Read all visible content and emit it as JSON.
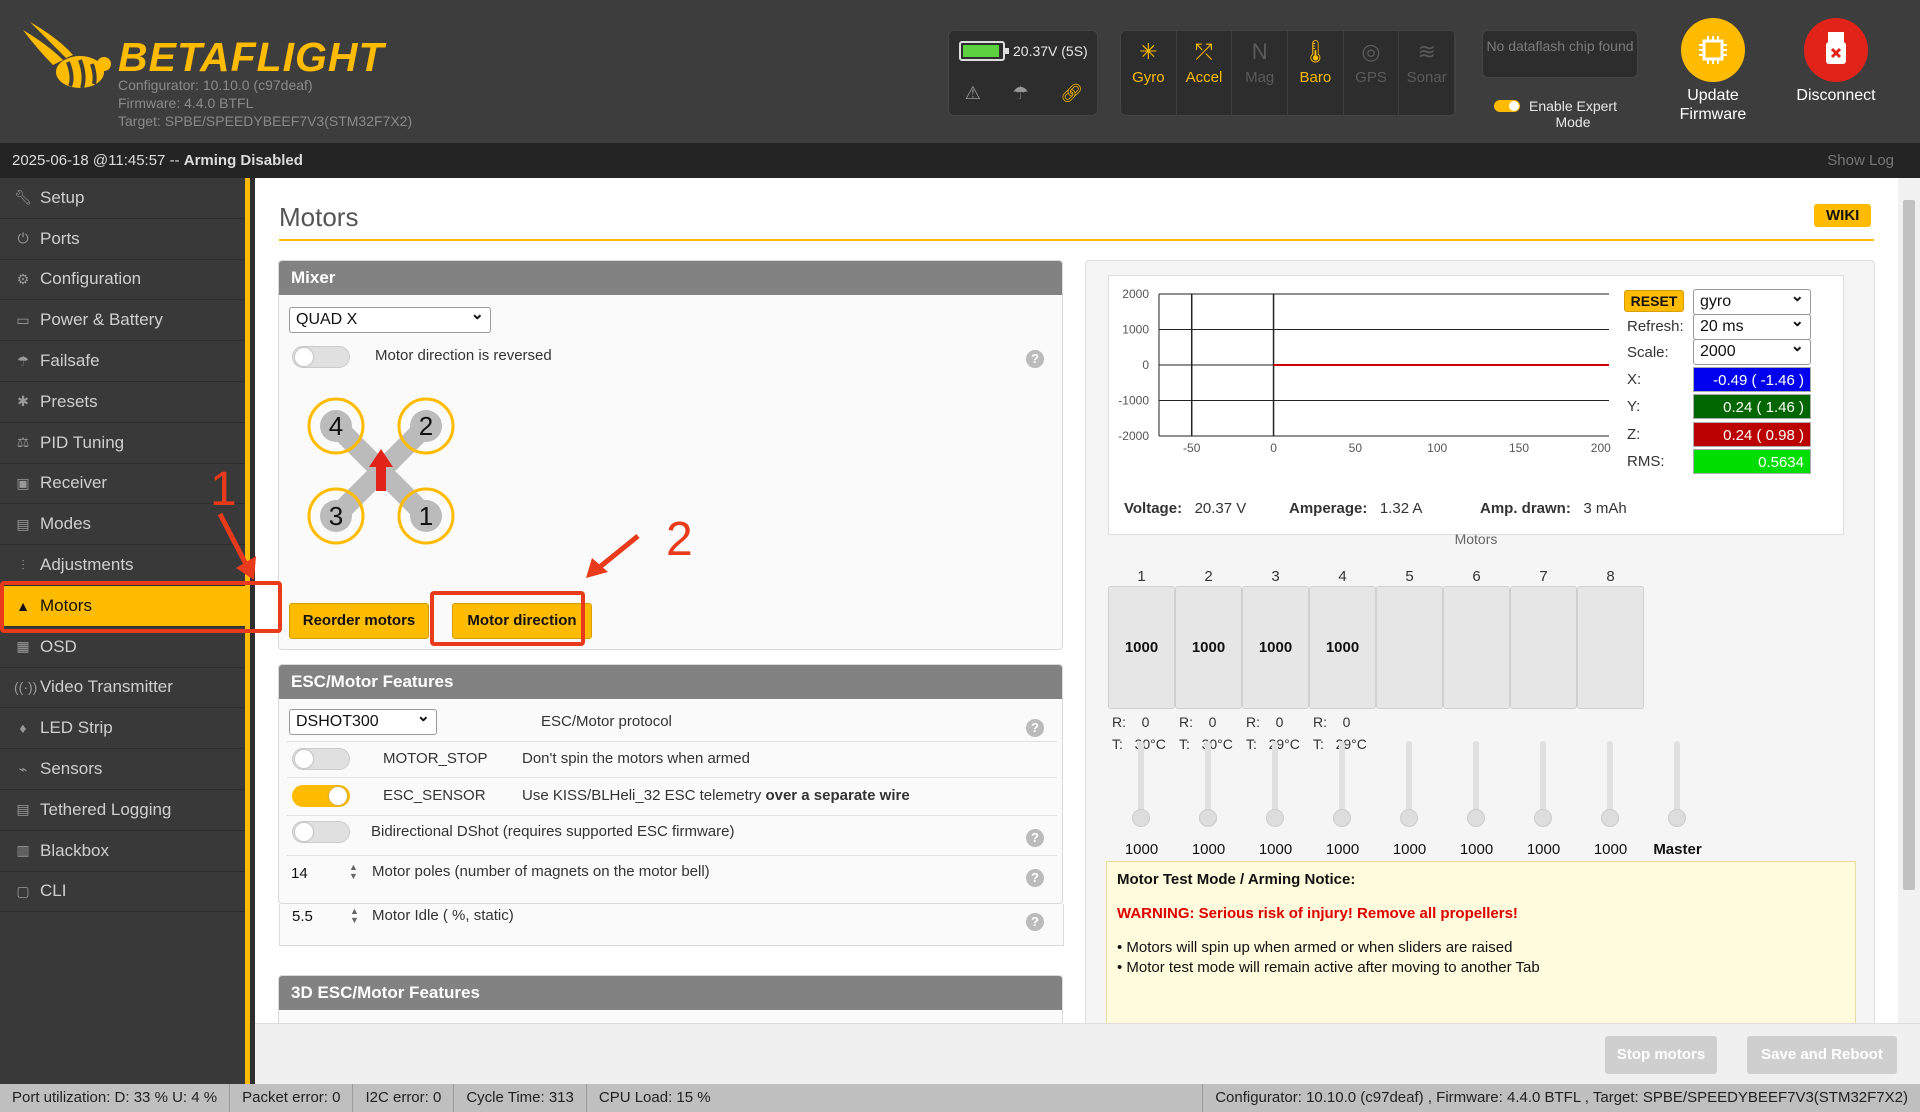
{
  "header": {
    "logo_text": "BETAFLIGHT",
    "configurator": "Configurator: 10.10.0 (c97deaf)",
    "firmware": "Firmware: 4.4.0 BTFL",
    "target": "Target: SPBE/SPEEDYBEEF7V3(STM32F7X2)",
    "voltage": "20.37V (5S)",
    "sensors": [
      {
        "label": "Gyro",
        "active": true
      },
      {
        "label": "Accel",
        "active": true
      },
      {
        "label": "Mag",
        "active": false
      },
      {
        "label": "Baro",
        "active": true
      },
      {
        "label": "GPS",
        "active": false
      },
      {
        "label": "Sonar",
        "active": false
      }
    ],
    "dataflash": "No dataflash chip found",
    "expert_mode": "Enable Expert Mode",
    "update_firmware": "Update Firmware",
    "disconnect": "Disconnect"
  },
  "logbar": {
    "timestamp": "2025-06-18 @11:45:57 -- ",
    "status": "Arming Disabled",
    "show_log": "Show Log"
  },
  "sidebar": {
    "items": [
      "Setup",
      "Ports",
      "Configuration",
      "Power & Battery",
      "Failsafe",
      "Presets",
      "PID Tuning",
      "Receiver",
      "Modes",
      "Adjustments",
      "Motors",
      "OSD",
      "Video Transmitter",
      "LED Strip",
      "Sensors",
      "Tethered Logging",
      "Blackbox",
      "CLI"
    ],
    "active": "Motors"
  },
  "page": {
    "title": "Motors",
    "wiki": "WIKI"
  },
  "mixer": {
    "title": "Mixer",
    "type": "QUAD X",
    "reversed_label": "Motor direction is reversed",
    "motor_labels": [
      "4",
      "2",
      "3",
      "1"
    ],
    "reorder_button": "Reorder motors",
    "direction_button": "Motor direction"
  },
  "esc": {
    "title": "ESC/Motor Features",
    "protocol": "DSHOT300",
    "protocol_label": "ESC/Motor protocol",
    "motor_stop": "MOTOR_STOP",
    "motor_stop_desc": "Don't spin the motors when armed",
    "esc_sensor": "ESC_SENSOR",
    "esc_sensor_desc": "Use KISS/BLHeli_32 ESC telemetry ",
    "esc_sensor_desc_bold": "over a separate wire",
    "bidir": "Bidirectional DShot (requires supported ESC firmware)",
    "poles_value": "14",
    "poles_label": "Motor poles (number of magnets on the motor bell)",
    "idle_value": "5.5",
    "idle_label": "Motor Idle ( %, static)"
  },
  "esc3d": {
    "title": "3D ESC/Motor Features"
  },
  "graph": {
    "reset": "RESET",
    "sensor": "gyro",
    "refresh_label": "Refresh:",
    "refresh": "20 ms",
    "scale_label": "Scale:",
    "scale": "2000",
    "x_label": "X:",
    "x_value": "-0.49 ( -1.46 )",
    "y_label": "Y:",
    "y_value": "0.24 ( 1.46 )",
    "z_label": "Z:",
    "z_value": "0.24 ( 0.98 )",
    "rms_label": "RMS:",
    "rms_value": "0.5634",
    "voltage_label": "Voltage:",
    "voltage": "20.37 V",
    "amperage_label": "Amperage:",
    "amperage": "1.32 A",
    "drawn_label": "Amp. drawn:",
    "drawn": "3 mAh",
    "colors": {
      "x": "#0000ee",
      "y": "#006600",
      "z": "#bb0000",
      "rms": "#00dd00"
    }
  },
  "chart_data": {
    "type": "line",
    "x_ticks": [
      "-50",
      "0",
      "50",
      "100",
      "150",
      "200"
    ],
    "y_ticks": [
      "2000",
      "1000",
      "0",
      "-1000",
      "-2000"
    ],
    "xlim": [
      -70,
      205
    ],
    "ylim": [
      -2000,
      2000
    ],
    "series": [
      {
        "x": [
          0,
          205
        ],
        "y": [
          0,
          0
        ]
      }
    ]
  },
  "motors": {
    "title": "Motors",
    "numbers": [
      "1",
      "2",
      "3",
      "4",
      "5",
      "6",
      "7",
      "8"
    ],
    "values": [
      "1000",
      "1000",
      "1000",
      "1000",
      "",
      "",
      "",
      ""
    ],
    "telemetry": [
      {
        "r": "R:",
        "rv": "0",
        "t": "T:",
        "tv": "30°C"
      },
      {
        "r": "R:",
        "rv": "0",
        "t": "T:",
        "tv": "30°C"
      },
      {
        "r": "R:",
        "rv": "0",
        "t": "T:",
        "tv": "29°C"
      },
      {
        "r": "R:",
        "rv": "0",
        "t": "T:",
        "tv": "29°C"
      }
    ],
    "slider_values": [
      "1000",
      "1000",
      "1000",
      "1000",
      "1000",
      "1000",
      "1000",
      "1000"
    ],
    "master_label": "Master"
  },
  "notice": {
    "title": "Motor Test Mode / Arming Notice:",
    "warning": "WARNING: Serious risk of injury! Remove all propellers!",
    "line1": "• Motors will spin up when armed or when sliders are raised",
    "line2": "• Motor test mode will remain active after moving to another Tab"
  },
  "buttons": {
    "stop": "Stop motors",
    "save": "Save and Reboot"
  },
  "status": {
    "port": "Port utilization: D: 33 % U: 4 %",
    "packet": "Packet error: 0",
    "i2c": "I2C error: 0",
    "cycle": "Cycle Time: 313",
    "cpu": "CPU Load: 15 %",
    "version": "Configurator: 10.10.0 (c97deaf) , Firmware: 4.4.0 BTFL , Target: SPBE/SPEEDYBEEF7V3(STM32F7X2)"
  },
  "annotations": [
    "1",
    "2"
  ]
}
